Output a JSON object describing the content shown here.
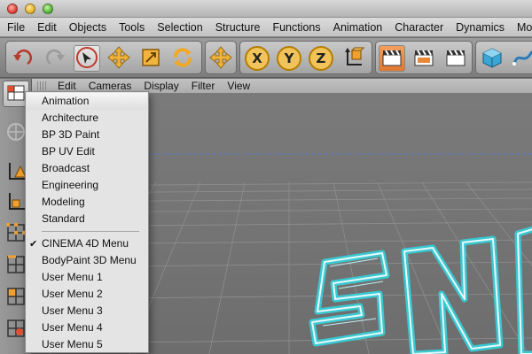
{
  "menubar": {
    "items": [
      "File",
      "Edit",
      "Objects",
      "Tools",
      "Selection",
      "Structure",
      "Functions",
      "Animation",
      "Character",
      "Dynamics",
      "MoGra"
    ]
  },
  "toolbar": {
    "axis_x": "X",
    "axis_y": "Y",
    "axis_z": "Z"
  },
  "viewport_menu": {
    "items": [
      "Edit",
      "Cameras",
      "Display",
      "Filter",
      "View"
    ]
  },
  "layout_menu": {
    "items": [
      "Animation",
      "Architecture",
      "BP 3D Paint",
      "BP UV Edit",
      "Broadcast",
      "Engineering",
      "Modeling",
      "Standard"
    ],
    "menus": [
      "CINEMA 4D Menu",
      "BodyPaint 3D Menu",
      "User Menu 1",
      "User Menu 2",
      "User Menu 3",
      "User Menu 4",
      "User Menu 5"
    ],
    "highlighted": "Animation",
    "checked": "CINEMA 4D Menu",
    "check_mark": "✔"
  },
  "colors": {
    "accent_orange": "#e8893a",
    "axis_yellow": "#f0c45a",
    "viewport_grid": "#8e8e8e",
    "horizon_line": "#5a78c8",
    "logo_cyan": "#35d2dc"
  }
}
